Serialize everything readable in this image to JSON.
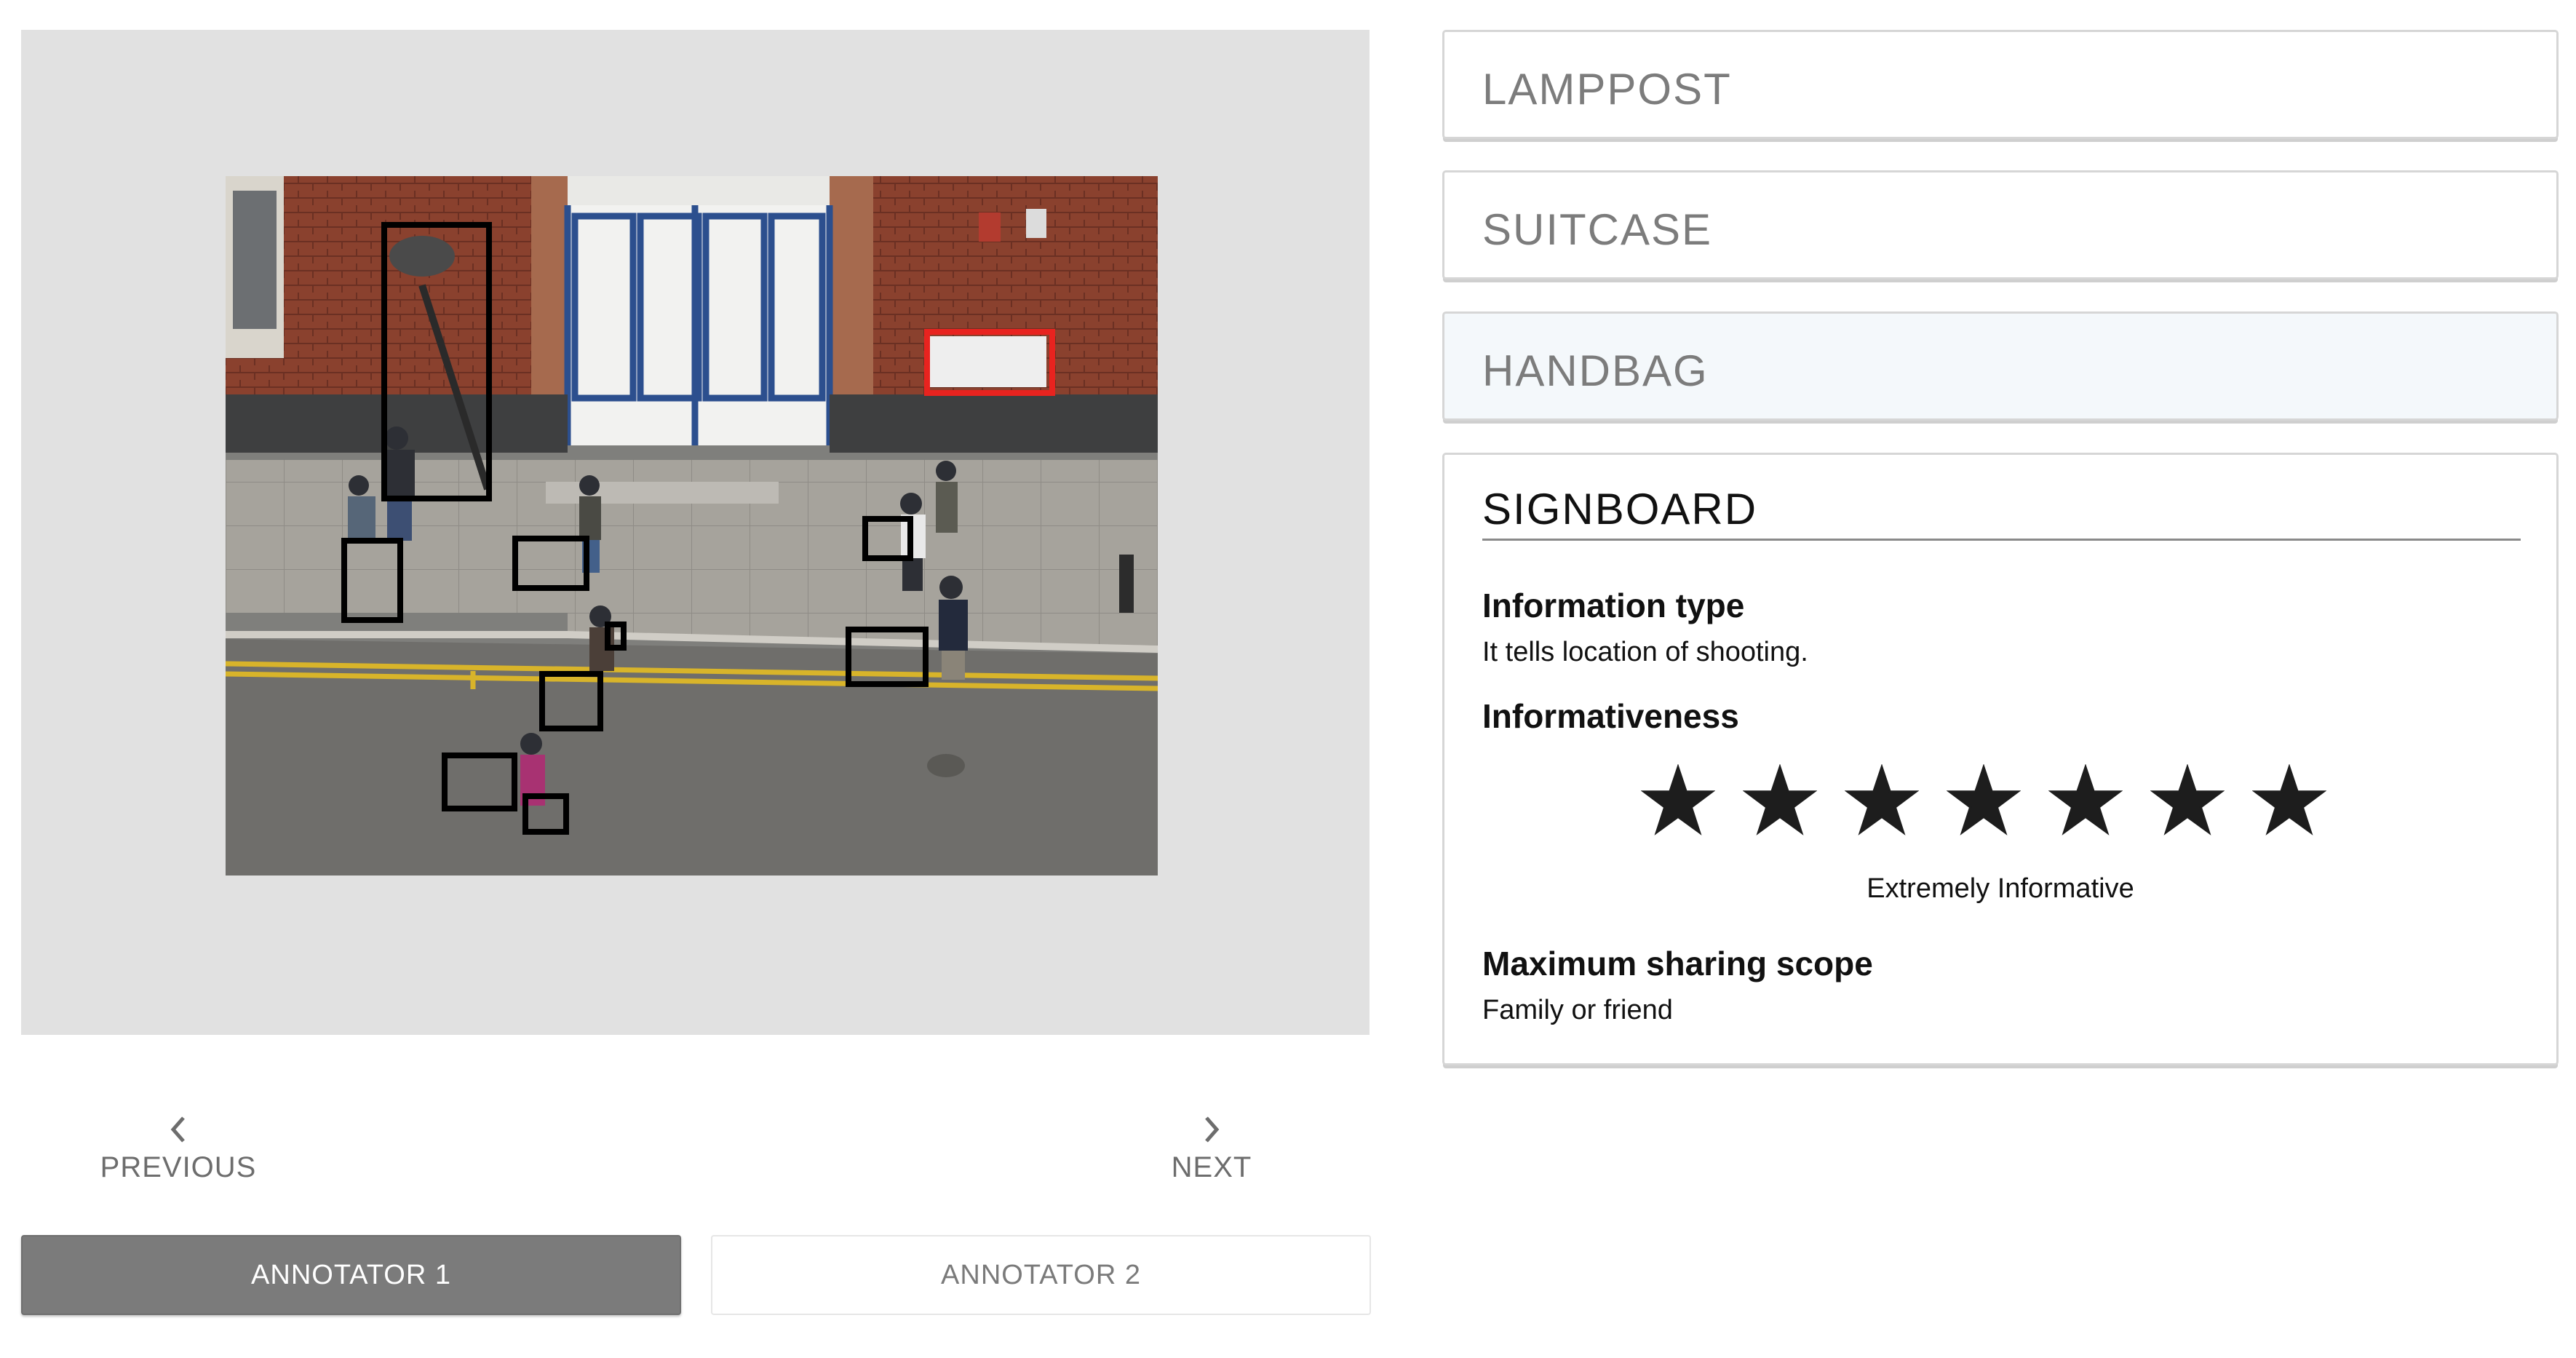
{
  "viewer": {
    "image_alt": "Street scene photo with annotated objects",
    "boxes": [
      {
        "name": "lamppost-box",
        "selected": false
      },
      {
        "name": "suitcase-box-1",
        "selected": false
      },
      {
        "name": "handbag-box-1",
        "selected": false
      },
      {
        "name": "suitcase-box-2",
        "selected": false
      },
      {
        "name": "handbag-box-2",
        "selected": false
      },
      {
        "name": "handbag-box-3",
        "selected": false
      },
      {
        "name": "suitcase-box-3",
        "selected": false
      },
      {
        "name": "suitcase-box-4",
        "selected": false
      },
      {
        "name": "suitcase-box-5",
        "selected": false
      },
      {
        "name": "handbag-box-4",
        "selected": false
      },
      {
        "name": "signboard-box",
        "selected": true
      }
    ]
  },
  "nav": {
    "previous_label": "PREVIOUS",
    "next_label": "NEXT"
  },
  "annotators": {
    "tab1_label": "ANNOTATOR 1",
    "tab2_label": "ANNOTATOR 2",
    "active": "ANNOTATOR 1"
  },
  "objects": {
    "lamppost": "LAMPPOST",
    "suitcase": "SUITCASE",
    "handbag": "HANDBAG",
    "signboard": {
      "title": "SIGNBOARD",
      "info_type_label": "Information type",
      "info_type_value": "It tells location of shooting.",
      "informativeness_label": "Informativeness",
      "rating": 7,
      "rating_max": 7,
      "rating_text": "Extremely Informative",
      "scope_label": "Maximum sharing scope",
      "scope_value": "Family or friend"
    }
  },
  "colors": {
    "selected_box": "#e8231f",
    "box": "#000000",
    "active_tab": "#7b7b7b",
    "hover_card": "#f4f8fb"
  },
  "icons": {
    "previous": "chevron-left-icon",
    "next": "chevron-right-icon",
    "star": "star-icon"
  }
}
